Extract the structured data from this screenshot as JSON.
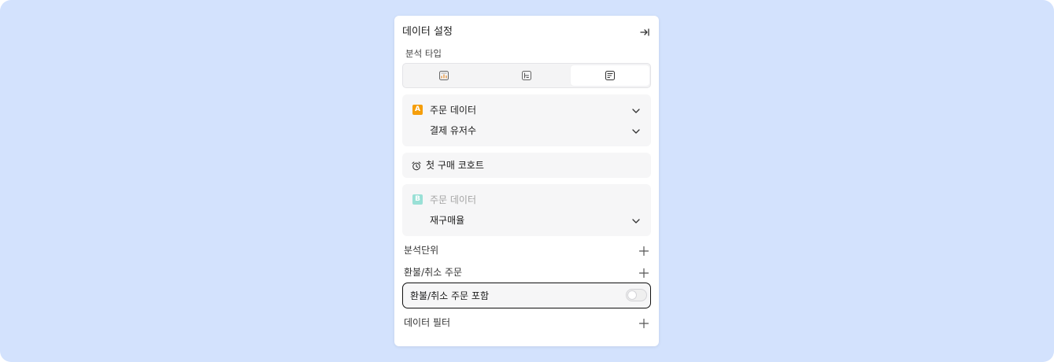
{
  "panel": {
    "title": "데이터 설정",
    "collapse_icon": "collapse-right-icon"
  },
  "analysis_type": {
    "label": "분석 타입",
    "options": [
      {
        "icon": "bar-chart-icon",
        "selected": false
      },
      {
        "icon": "funnel-chart-icon",
        "selected": false
      },
      {
        "icon": "cohort-table-icon",
        "selected": true
      }
    ]
  },
  "event_a": {
    "badge": "A",
    "badge_color": "#f59e0b",
    "source": "주문 데이터",
    "metric": "결제 유저수"
  },
  "cohort": {
    "icon": "alarm-clock-icon",
    "label": "첫 구매 코호트"
  },
  "event_b": {
    "badge": "B",
    "badge_color": "#99e0d6",
    "source": "주문 데이터",
    "metric": "재구매율"
  },
  "options": {
    "analysis_unit": "분석단위",
    "refund_cancel": "환불/취소 주문",
    "include_refund_label": "환불/취소 주문 포함",
    "include_refund_on": false,
    "data_filter": "데이터 필터"
  },
  "colors": {
    "background": "#d3e2fd",
    "panel": "#ffffff",
    "card": "#f6f6f7"
  }
}
